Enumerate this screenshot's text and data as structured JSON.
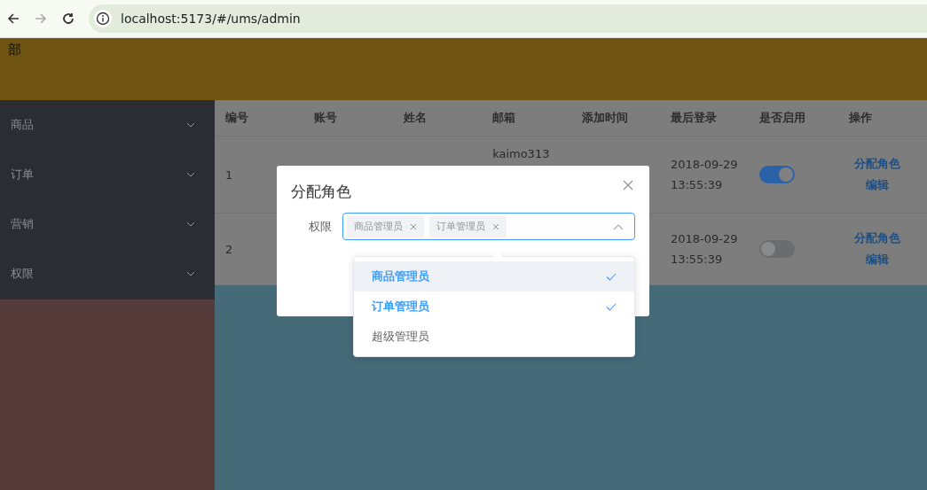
{
  "browser": {
    "url": "localhost:5173/#/ums/admin"
  },
  "header": {
    "text": "部"
  },
  "sidebar": {
    "items": [
      {
        "label": "商品",
        "expanded": false
      },
      {
        "label": "订单",
        "expanded": false
      },
      {
        "label": "营销",
        "expanded": false
      },
      {
        "label": "权限",
        "expanded": false
      }
    ]
  },
  "table": {
    "columns": [
      "编号",
      "账号",
      "姓名",
      "邮箱",
      "添加时间",
      "最后登录",
      "是否启用",
      "操作"
    ],
    "rows": [
      {
        "id": "1",
        "email": "kaimo313",
        "last_login": [
          "2018-09-29",
          "13:55:39"
        ],
        "enabled": true,
        "actions": [
          "分配角色",
          "编辑"
        ]
      },
      {
        "id": "2",
        "last_login": [
          "2018-09-29",
          "13:55:39"
        ],
        "enabled": false,
        "actions": [
          "分配角色",
          "编辑"
        ]
      }
    ]
  },
  "dialog": {
    "title": "分配角色",
    "field_label": "权限",
    "select": {
      "tags": [
        {
          "label": "商品管理员"
        },
        {
          "label": "订单管理员"
        }
      ],
      "expanded": true,
      "options": [
        {
          "label": "商品管理员",
          "selected": true,
          "highlighted": true
        },
        {
          "label": "订单管理员",
          "selected": true,
          "highlighted": false
        },
        {
          "label": "超级管理员",
          "selected": false,
          "highlighted": false
        }
      ]
    }
  }
}
